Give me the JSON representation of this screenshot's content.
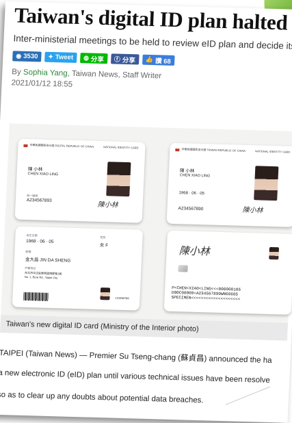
{
  "article": {
    "headline": "Taiwan's digital ID plan halted",
    "subheadline": "Inter-ministerial meetings to be held to review eID plan and decide its fate",
    "share": {
      "views": "3530",
      "tweet": "Tweet",
      "line": "分享",
      "facebook": "分享",
      "like": "讚 68"
    },
    "byline_prefix": "By ",
    "author": "Sophia Yang",
    "byline_suffix": ", Taiwan News, Staff Writer",
    "date": "2021/01/12 18:55",
    "caption": "Taiwan's new digital ID card (Ministry of the Interior photo)",
    "body_lines": [
      "TAIPEI (Taiwan News) — Premier Su Tseng-chang (蘇貞昌) announced the ha",
      "a new electronic ID (eID) plan until various technical issues have been resolve",
      "so as to clear up any doubts about potential data breaches."
    ]
  },
  "cards": {
    "front1": {
      "header": "中華民國國民身分證 DIGITAL REPUBLIC OF CHINA",
      "header_right": "NATIONAL IDENTITY CARD",
      "name_zh": "陳 小林",
      "name_en": "CHEN XIAO LING",
      "id_label": "統一編號",
      "id_number": "A234567893",
      "signature": "陳小林"
    },
    "back1": {
      "dob_label": "出生日期",
      "dob": "1968 · 06 · 05",
      "sex_label": "性別",
      "sex": "女 F",
      "spouse_label": "配偶",
      "spouse": "金大昌 JIN DA SHENG",
      "address_label": "戶籍地址",
      "address_zh": "台北市中正區黎明里博愛路1號",
      "address_en": "No. 1, Bo'ai Rd., Taipei City",
      "card_no": "123456789"
    },
    "front2": {
      "header": "中華民國國民身分證 TAIWAN REPUBLIC OF CHINA",
      "header_right": "NATIONAL IDENTITY CARD",
      "name_zh": "陳 小林",
      "name_en": "CHEN XIAO LING",
      "dob": "1968 · 06 · 05",
      "id_number": "A234567890",
      "signature": "陳小林"
    },
    "back2": {
      "signature": "陳小林",
      "mrz": "P<CHEN<XIAO<LING<<<000000105\nD00C00000<A234567890WN60605\nSPECIMEN<<<<<<<<<<<<<<<<<<<<"
    }
  },
  "colors": {
    "views": "#2c6fb5",
    "tweet": "#2aa3ef",
    "line": "#00b900",
    "facebook": "#3b5998",
    "like": "#3b7ddd",
    "author": "#2d8a3e"
  }
}
